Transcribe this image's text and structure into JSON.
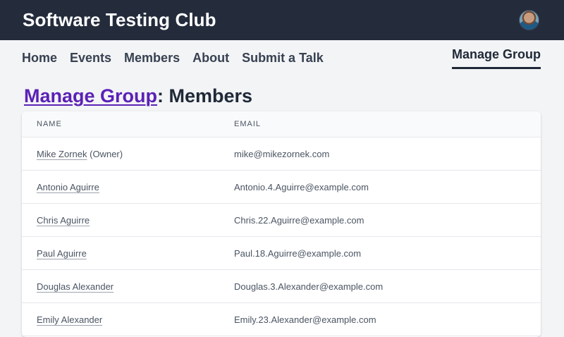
{
  "header": {
    "brand": "Software Testing Club"
  },
  "nav": {
    "items": [
      "Home",
      "Events",
      "Members",
      "About",
      "Submit a Talk"
    ],
    "manage_group": "Manage Group"
  },
  "page": {
    "title_link": "Manage Group",
    "title_suffix": ": Members"
  },
  "table": {
    "columns": [
      "NAME",
      "EMAIL"
    ],
    "rows": [
      {
        "name": "Mike Zornek",
        "note": " (Owner)",
        "email": "mike@mikezornek.com"
      },
      {
        "name": "Antonio Aguirre",
        "note": "",
        "email": "Antonio.4.Aguirre@example.com"
      },
      {
        "name": "Chris Aguirre",
        "note": "",
        "email": "Chris.22.Aguirre@example.com"
      },
      {
        "name": "Paul Aguirre",
        "note": "",
        "email": "Paul.18.Aguirre@example.com"
      },
      {
        "name": "Douglas Alexander",
        "note": "",
        "email": "Douglas.3.Alexander@example.com"
      },
      {
        "name": "Emily Alexander",
        "note": "",
        "email": "Emily.23.Alexander@example.com"
      }
    ]
  }
}
